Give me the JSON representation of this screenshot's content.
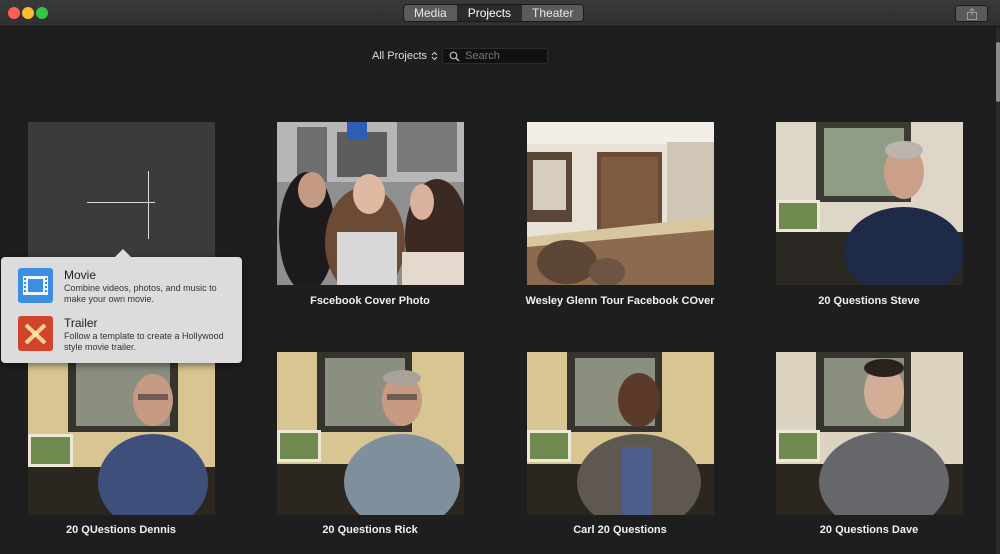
{
  "window": {
    "tabs": [
      {
        "label": "Media",
        "active": false
      },
      {
        "label": "Projects",
        "active": true
      },
      {
        "label": "Theater",
        "active": false
      }
    ]
  },
  "toolbar": {
    "filter_label": "All Projects",
    "search_placeholder": "Search"
  },
  "popover": {
    "items": [
      {
        "title": "Movie",
        "description": "Combine videos, photos, and music to make your own movie.",
        "icon": "movie-film-icon",
        "color": "#3d8ee0"
      },
      {
        "title": "Trailer",
        "description": "Follow a template to create a Hollywood style movie trailer.",
        "icon": "trailer-icon",
        "color": "#d0432c"
      }
    ]
  },
  "projects": [
    {
      "title": "Fscebook Cover Photo",
      "thumbnail": "three-women-photo"
    },
    {
      "title": "Wesley Glenn Tour Facebook COver",
      "thumbnail": "kitchen-interior-photo"
    },
    {
      "title": "20 Questions Steve",
      "thumbnail": "man-navy-polo-photo"
    },
    {
      "title": "20 QUestions Dennis",
      "thumbnail": "man-blue-shirt-glasses-photo"
    },
    {
      "title": "20 Questions Rick",
      "thumbnail": "man-grey-shirt-glasses-photo"
    },
    {
      "title": "Carl 20 Questions",
      "thumbnail": "man-grey-cardigan-photo"
    },
    {
      "title": "20 Questions Dave",
      "thumbnail": "man-grey-hoodie-photo"
    }
  ],
  "colors": {
    "background": "#1e1e1e",
    "new_tile": "#3b3b3b",
    "popover": "#dcdcdc"
  }
}
